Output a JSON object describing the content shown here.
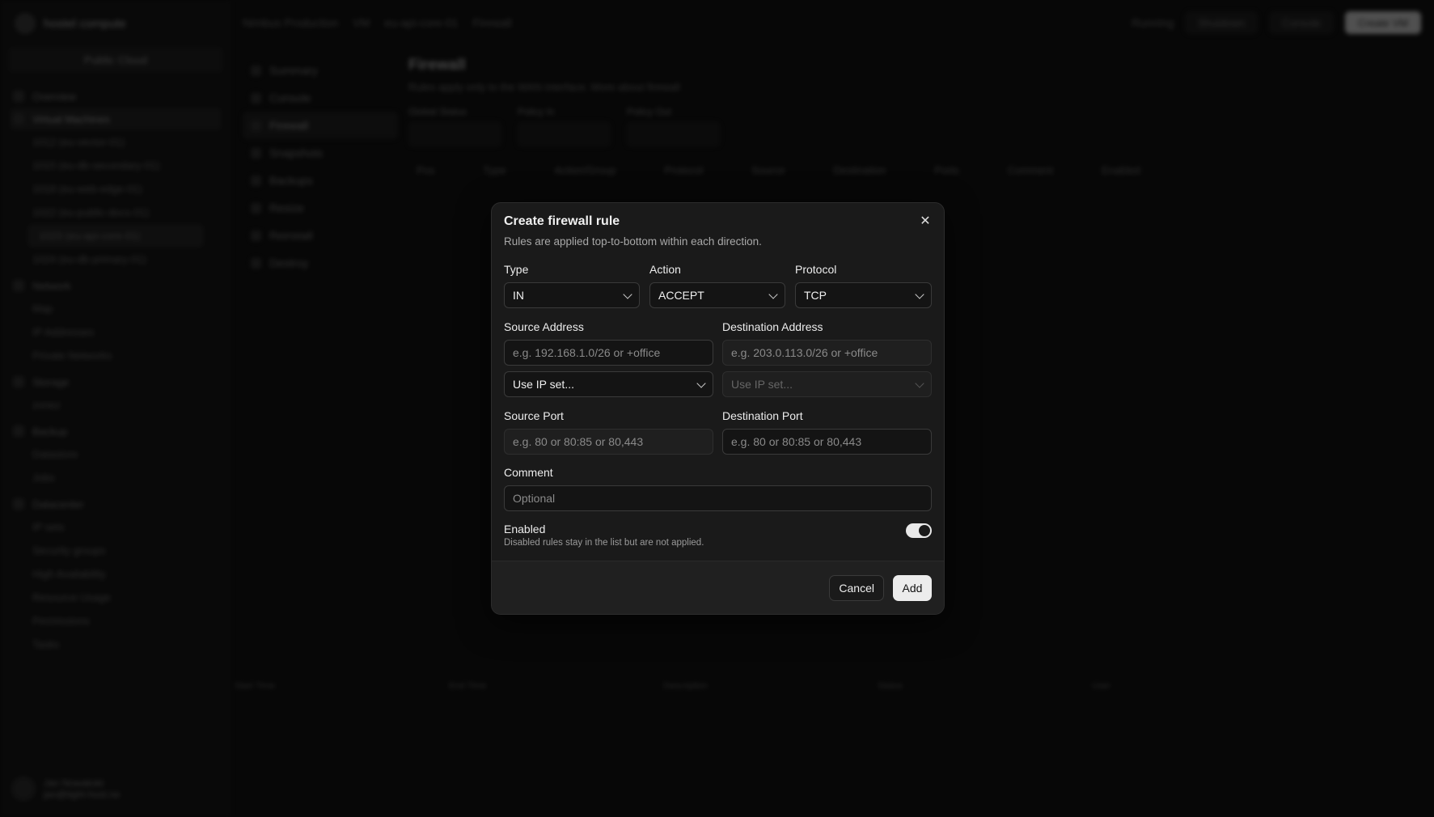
{
  "background": {
    "brand": "hostel compute",
    "cloud": "Public Cloud",
    "nav": [
      {
        "label": "Overview"
      },
      {
        "label": "Virtual Machines"
      },
      {
        "label": "Network"
      },
      {
        "label": "Storage"
      },
      {
        "label": "Backup"
      },
      {
        "label": "Datacenter"
      }
    ],
    "vm_items": [
      "1012 (eu-vector-01)",
      "1015 (eu-db-secondary-01)",
      "1018 (eu-web-edge-01)",
      "1022 (eu-public-docs-01)",
      "1023 (eu-api-core-01)",
      "1024 (eu-db-primary-01)"
    ],
    "network_items": [
      "Map",
      "IP Addresses",
      "Private Networks"
    ],
    "storage_items": [
      "zonez"
    ],
    "backup_items": [
      "Datastore",
      "Jobs"
    ],
    "datacenter_items": [
      "IP sets",
      "Security groups",
      "High Availability",
      "Resource Usage",
      "Permissions",
      "Tasks"
    ],
    "user": {
      "name": "Jan Nowakski",
      "sub": "jan@tight-host.ne"
    },
    "breadcrumb": [
      "Nimbus Production",
      "VM",
      "eu-api-core-01",
      "Firewall"
    ],
    "top_buttons": [
      "Running",
      "Shutdown",
      "Console",
      "Create VM"
    ],
    "subnav": [
      "Summary",
      "Console",
      "Firewall",
      "Snapshots",
      "Backups",
      "Resize",
      "Reinstall",
      "Destroy"
    ],
    "page_title": "Firewall",
    "page_sub": "Rules apply only to the WAN interface. More about firewall",
    "filters": [
      "Global Status",
      "Policy In",
      "Policy Out"
    ],
    "table_headers": [
      "Pos",
      "Type",
      "Action/Group",
      "Protocol",
      "Source",
      "Destination",
      "Ports",
      "Comment",
      "Enabled"
    ],
    "log_headers": [
      "Start Time",
      "End Time",
      "Description",
      "Status",
      "User"
    ]
  },
  "modal": {
    "title": "Create firewall rule",
    "description": "Rules are applied top-to-bottom within each direction.",
    "type_label": "Type",
    "type_value": "IN",
    "action_label": "Action",
    "action_value": "ACCEPT",
    "protocol_label": "Protocol",
    "protocol_value": "TCP",
    "source_address_label": "Source Address",
    "source_address_placeholder": "e.g. 192.168.1.0/26 or +office",
    "source_ipset_value": "Use IP set...",
    "destination_address_label": "Destination Address",
    "destination_address_placeholder": "e.g. 203.0.113.0/26 or +office",
    "destination_ipset_value": "Use IP set...",
    "source_port_label": "Source Port",
    "source_port_placeholder": "e.g. 80 or 80:85 or 80,443",
    "destination_port_label": "Destination Port",
    "destination_port_placeholder": "e.g. 80 or 80:85 or 80,443",
    "comment_label": "Comment",
    "comment_placeholder": "Optional",
    "enabled_label": "Enabled",
    "enabled_hint": "Disabled rules stay in the list but are not applied.",
    "enabled": true,
    "cancel_label": "Cancel",
    "add_label": "Add"
  }
}
